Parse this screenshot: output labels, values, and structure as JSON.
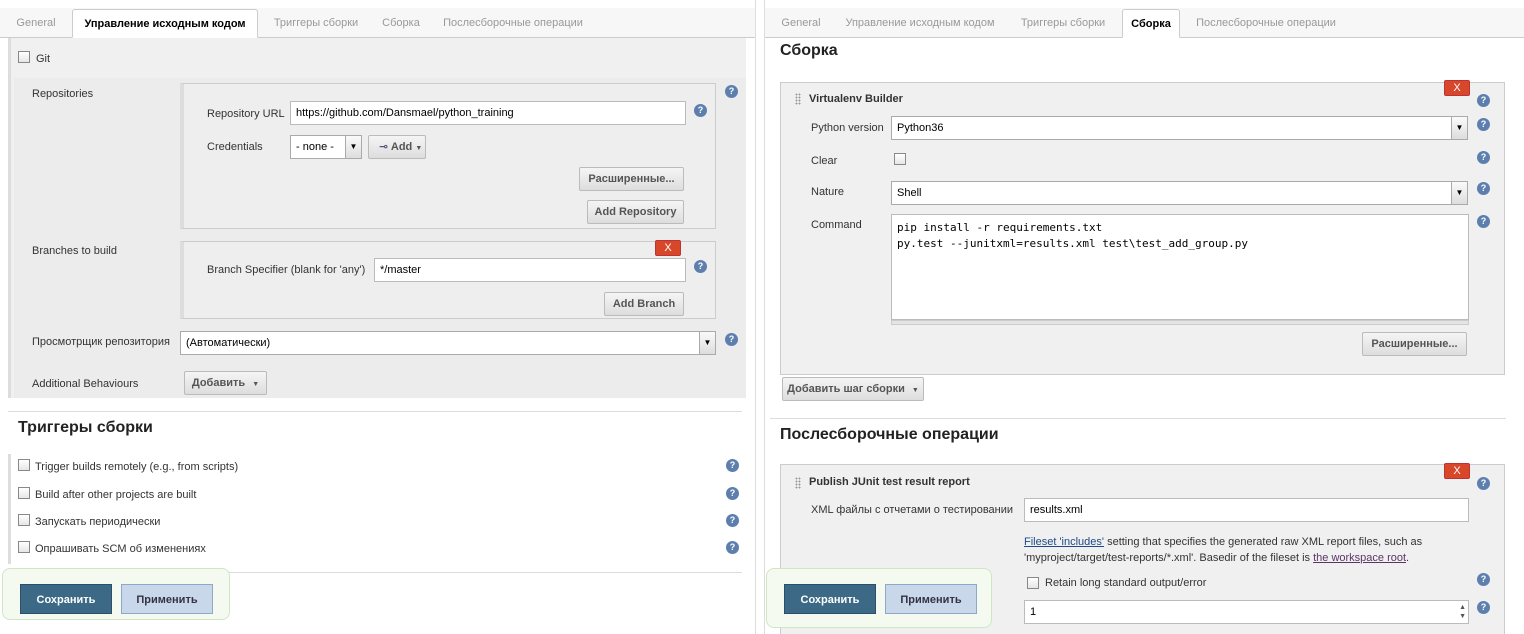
{
  "left": {
    "tabs": [
      "General",
      "Управление исходным кодом",
      "Триггеры сборки",
      "Сборка",
      "Послесборочные операции"
    ],
    "scm": {
      "git_label": "Git",
      "repositories_label": "Repositories",
      "repo_url_label": "Repository URL",
      "repo_url_value": "https://github.com/Dansmael/python_training",
      "credentials_label": "Credentials",
      "credentials_value": "- none -",
      "add_label": "Add",
      "advanced_label": "Расширенные...",
      "add_repository_label": "Add Repository",
      "branches_label": "Branches to build",
      "branch_specifier_label": "Branch Specifier (blank for 'any')",
      "branch_specifier_value": "*/master",
      "add_branch_label": "Add Branch",
      "delete_label": "X",
      "repo_browser_label": "Просмотрщик репозитория",
      "repo_browser_value": "(Автоматически)",
      "additional_behaviours_label": "Additional Behaviours",
      "add_behaviour_label": "Добавить"
    },
    "triggers": {
      "title": "Триггеры сборки",
      "items": [
        "Trigger builds remotely (e.g., from scripts)",
        "Build after other projects are built",
        "Запускать периодически",
        "Опрашивать SCM об изменениях"
      ]
    },
    "save_label": "Сохранить",
    "apply_label": "Применить"
  },
  "right": {
    "tabs": [
      "General",
      "Управление исходным кодом",
      "Триггеры сборки",
      "Сборка",
      "Послесборочные операции"
    ],
    "build": {
      "title": "Сборка",
      "step_title": "Virtualenv Builder",
      "delete_label": "X",
      "python_version_label": "Python version",
      "python_version_value": "Python36",
      "clear_label": "Clear",
      "nature_label": "Nature",
      "nature_value": "Shell",
      "command_label": "Command",
      "command_value": "pip install -r requirements.txt\npy.test --junitxml=results.xml test\\test_add_group.py",
      "advanced_label": "Расширенные...",
      "add_step_label": "Добавить шаг сборки"
    },
    "post": {
      "title": "Послесборочные операции",
      "step_title": "Publish JUnit test result report",
      "delete_label": "X",
      "xml_label": "XML файлы с отчетами о тестировании",
      "xml_value": "results.xml",
      "help_link1": "Fileset 'includes'",
      "help_text1": " setting that specifies the generated raw XML report files, such as",
      "help_text2": "'myproject/target/test-reports/*.xml'. Basedir of the fileset is ",
      "help_link2": "the workspace root",
      "help_text3": ".",
      "retain_label": "Retain long standard output/error",
      "health_value": "1"
    },
    "save_label": "Сохранить",
    "apply_label": "Применить"
  }
}
